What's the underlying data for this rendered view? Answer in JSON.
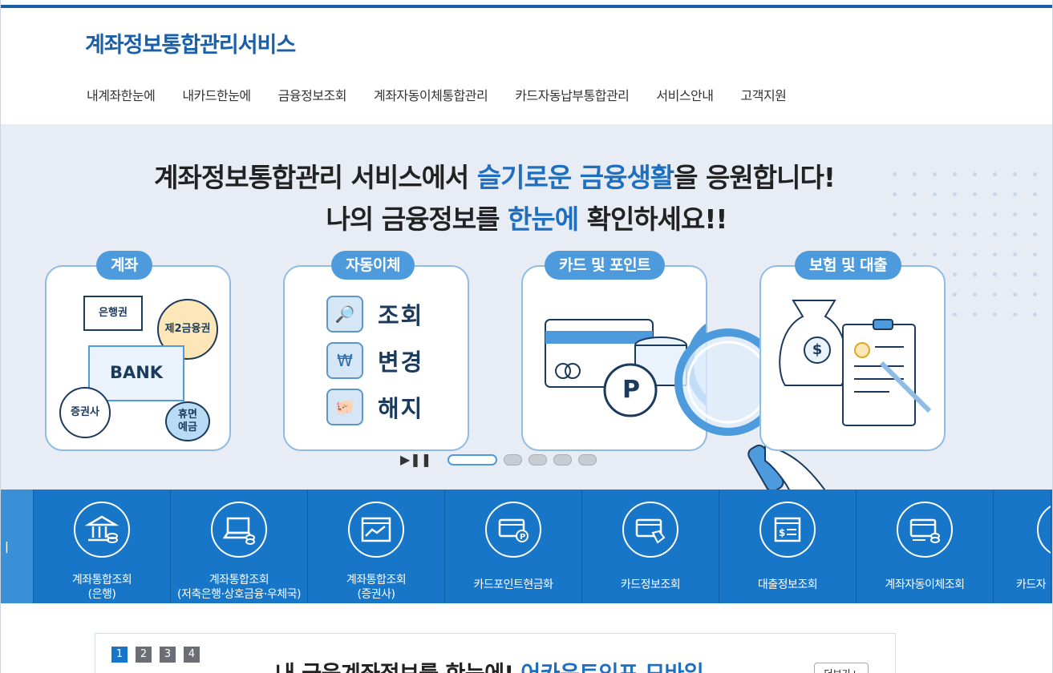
{
  "header": {
    "logo": "계좌정보통합관리서비스"
  },
  "nav": {
    "items": [
      "내계좌한눈에",
      "내카드한눈에",
      "금융정보조회",
      "계좌자동이체통합관리",
      "카드자동납부통합관리",
      "서비스안내",
      "고객지원"
    ]
  },
  "visual": {
    "line1_a": "계좌정보통합관리 서비스에서 ",
    "line1_hl": "슬기로운 금융생활",
    "line1_b": "을 응원합니다!",
    "line2_a": "나의 금융정보를 ",
    "line2_hl": "한눈에",
    "line2_b": " 확인하세요!!",
    "cards": [
      {
        "tag": "계좌",
        "bubbles": [
          "은행권",
          "제2금융권",
          "BANK",
          "증권사",
          "휴면\n예금"
        ]
      },
      {
        "tag": "자동이체",
        "rows": [
          "조회",
          "변경",
          "해지"
        ]
      },
      {
        "tag": "카드 및 포인트",
        "p_label": "P"
      },
      {
        "tag": "보험 및 대출",
        "dollar": "$"
      }
    ],
    "slider": {
      "play_pause": "▶❚❚",
      "pages": 5,
      "active": 1
    }
  },
  "quick": {
    "first_partial": "ㅣ",
    "items": [
      {
        "label": "계좌통합조회\n(은행)",
        "icon": "bank-icon"
      },
      {
        "label": "계좌통합조회\n(저축은행·상호금융·우체국)",
        "icon": "laptop-icon"
      },
      {
        "label": "계좌통합조회\n(증권사)",
        "icon": "chart-icon"
      },
      {
        "label": "카드포인트현금화",
        "icon": "point-card-icon"
      },
      {
        "label": "카드정보조회",
        "icon": "card-hand-icon"
      },
      {
        "label": "대출정보조회",
        "icon": "document-icon"
      },
      {
        "label": "계좌자동이체조회",
        "icon": "transfer-icon"
      },
      {
        "label": "카드자",
        "icon": "card-icon"
      }
    ]
  },
  "notice": {
    "pages": [
      "1",
      "2",
      "3",
      "4"
    ],
    "title_a": "내 금융계좌정보를 한눈에! ",
    "title_hl": "어카운트인포 모바일",
    "more": "더보기+"
  },
  "colors": {
    "brand": "#1a5fa8",
    "quick_bg": "#1776c8",
    "accent": "#4d9bdc"
  }
}
